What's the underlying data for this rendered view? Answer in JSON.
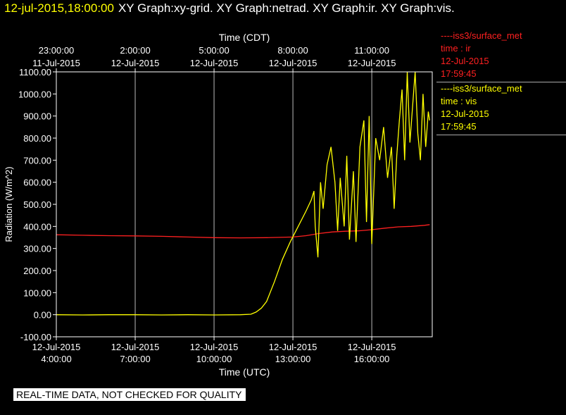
{
  "header": {
    "datetime": "12-jul-2015,18:00:00",
    "graphs": "XY Graph:xy-grid.  XY Graph:netrad.  XY Graph:ir.  XY Graph:vis."
  },
  "legend": [
    {
      "name": "----iss3/surface_met",
      "field": "time : ir",
      "date": "12-Jul-2015",
      "time": "17:59:45",
      "color": "#ff2020"
    },
    {
      "name": "----iss3/surface_met",
      "field": "time : vis",
      "date": "12-Jul-2015",
      "time": "17:59:45",
      "color": "#ffff00"
    }
  ],
  "footer": {
    "quality_note": "REAL-TIME DATA, NOT CHECKED FOR QUALITY"
  },
  "colors": {
    "background": "#000000",
    "ir": "#ff2020",
    "vis": "#ffff00",
    "grid": "#ffffff"
  },
  "chart_data": {
    "type": "line",
    "xlabel": "Time (UTC)",
    "x2label": "Time (CDT)",
    "ylabel": "Radiation (W/m^2)",
    "xlim_hours_utc": [
      4.0,
      18.3
    ],
    "ylim": [
      -100,
      1100
    ],
    "yticks": [
      "-100.00",
      "0.00",
      "100.00",
      "200.00",
      "300.00",
      "400.00",
      "500.00",
      "600.00",
      "700.00",
      "800.00",
      "900.00",
      "1000.00",
      "1100.00"
    ],
    "xticks_utc": [
      {
        "hour": 4,
        "date": "12-Jul-2015",
        "time": "4:00:00"
      },
      {
        "hour": 7,
        "date": "12-Jul-2015",
        "time": "7:00:00"
      },
      {
        "hour": 10,
        "date": "12-Jul-2015",
        "time": "10:00:00"
      },
      {
        "hour": 13,
        "date": "12-Jul-2015",
        "time": "13:00:00"
      },
      {
        "hour": 16,
        "date": "12-Jul-2015",
        "time": "16:00:00"
      }
    ],
    "xticks_cdt": [
      {
        "hour": 4,
        "time": "23:00:00",
        "date": "11-Jul-2015"
      },
      {
        "hour": 7,
        "time": "2:00:00",
        "date": "12-Jul-2015"
      },
      {
        "hour": 10,
        "time": "5:00:00",
        "date": "12-Jul-2015"
      },
      {
        "hour": 13,
        "time": "8:00:00",
        "date": "12-Jul-2015"
      },
      {
        "hour": 16,
        "time": "11:00:00",
        "date": "12-Jul-2015"
      }
    ],
    "grid": true,
    "series": [
      {
        "name": "time : ir",
        "color": "#ff2020",
        "points": [
          [
            4.0,
            362
          ],
          [
            5.0,
            360
          ],
          [
            6.0,
            358
          ],
          [
            7.0,
            357
          ],
          [
            8.0,
            355
          ],
          [
            9.0,
            352
          ],
          [
            10.0,
            349
          ],
          [
            11.0,
            348
          ],
          [
            12.0,
            349
          ],
          [
            13.0,
            352
          ],
          [
            13.5,
            358
          ],
          [
            14.0,
            368
          ],
          [
            14.5,
            375
          ],
          [
            15.0,
            378
          ],
          [
            15.5,
            380
          ],
          [
            16.0,
            385
          ],
          [
            16.5,
            392
          ],
          [
            17.0,
            398
          ],
          [
            17.5,
            400
          ],
          [
            18.0,
            405
          ],
          [
            18.2,
            408
          ]
        ]
      },
      {
        "name": "time : vis",
        "color": "#ffff00",
        "points": [
          [
            4.0,
            0
          ],
          [
            5.0,
            -1
          ],
          [
            6.0,
            0
          ],
          [
            7.0,
            0
          ],
          [
            8.0,
            -1
          ],
          [
            9.0,
            0
          ],
          [
            10.0,
            -1
          ],
          [
            11.0,
            0
          ],
          [
            11.4,
            2
          ],
          [
            11.6,
            12
          ],
          [
            11.8,
            30
          ],
          [
            12.0,
            60
          ],
          [
            12.3,
            150
          ],
          [
            12.6,
            250
          ],
          [
            12.9,
            330
          ],
          [
            13.2,
            400
          ],
          [
            13.5,
            470
          ],
          [
            13.7,
            520
          ],
          [
            13.8,
            560
          ],
          [
            13.85,
            400
          ],
          [
            13.95,
            260
          ],
          [
            14.05,
            600
          ],
          [
            14.15,
            480
          ],
          [
            14.3,
            680
          ],
          [
            14.45,
            760
          ],
          [
            14.6,
            600
          ],
          [
            14.7,
            380
          ],
          [
            14.8,
            620
          ],
          [
            14.95,
            400
          ],
          [
            15.05,
            720
          ],
          [
            15.15,
            340
          ],
          [
            15.3,
            650
          ],
          [
            15.4,
            330
          ],
          [
            15.55,
            760
          ],
          [
            15.7,
            880
          ],
          [
            15.8,
            420
          ],
          [
            15.9,
            900
          ],
          [
            16.0,
            320
          ],
          [
            16.15,
            800
          ],
          [
            16.3,
            700
          ],
          [
            16.45,
            850
          ],
          [
            16.6,
            620
          ],
          [
            16.75,
            760
          ],
          [
            16.85,
            480
          ],
          [
            16.95,
            720
          ],
          [
            17.05,
            880
          ],
          [
            17.15,
            1020
          ],
          [
            17.25,
            700
          ],
          [
            17.35,
            1100
          ],
          [
            17.45,
            780
          ],
          [
            17.55,
            940
          ],
          [
            17.65,
            1100
          ],
          [
            17.75,
            820
          ],
          [
            17.85,
            700
          ],
          [
            17.95,
            1000
          ],
          [
            18.05,
            760
          ],
          [
            18.15,
            920
          ],
          [
            18.2,
            880
          ]
        ]
      }
    ]
  }
}
